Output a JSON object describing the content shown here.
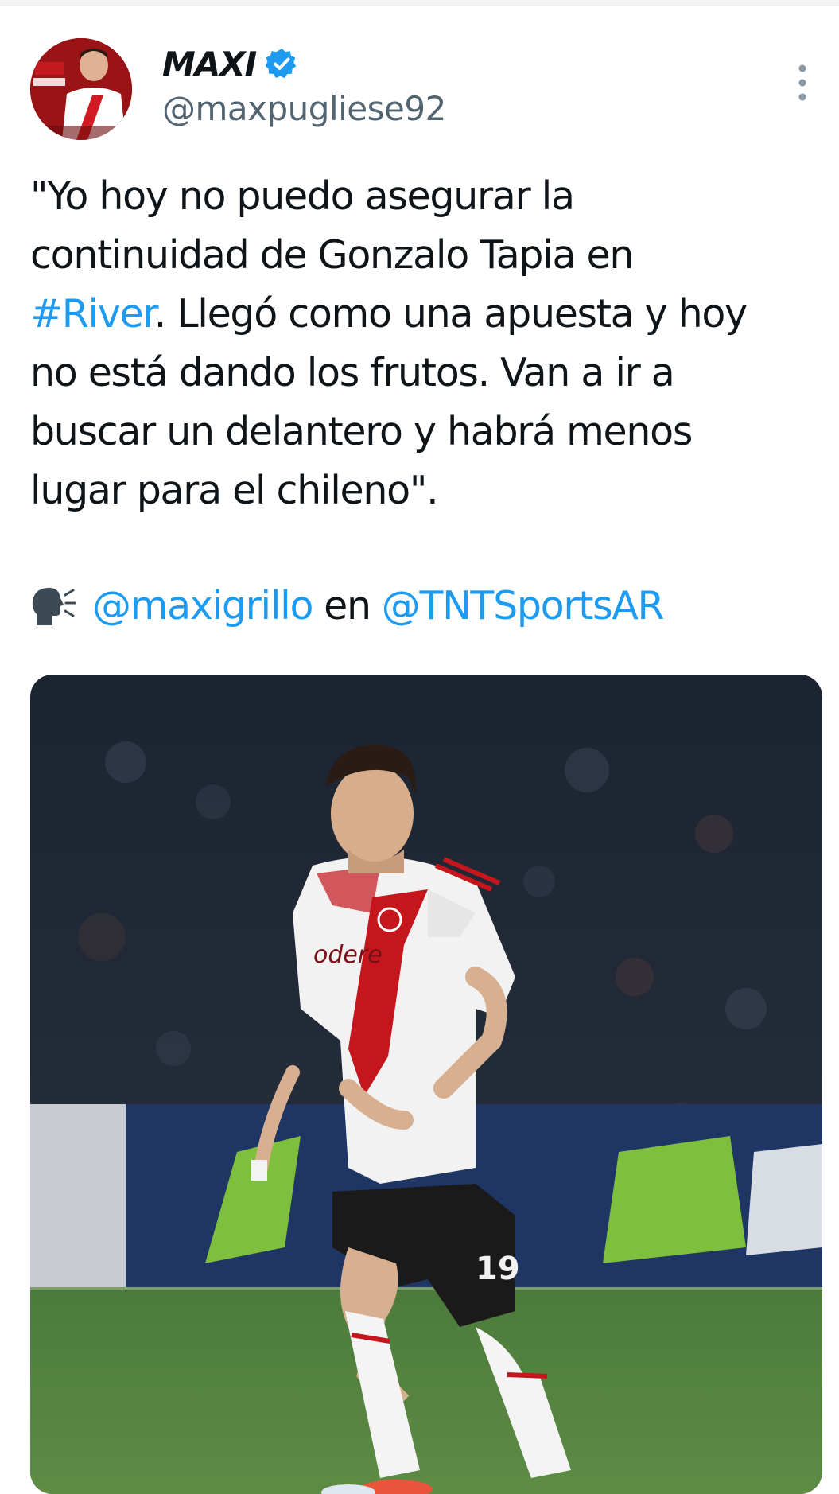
{
  "tweet": {
    "author": {
      "display_name": "MAXI",
      "handle": "@maxpugliese92",
      "avatar_icon": "avatar-photo",
      "verified_icon": "verified-badge-icon",
      "verified_color": "#1d9bf0"
    },
    "menu_icon": "more-vertical-icon",
    "text_lines": [
      {
        "parts": [
          {
            "text": "\"Yo hoy no puedo asegurar la"
          }
        ]
      },
      {
        "parts": [
          {
            "text": "continuidad de Gonzalo Tapia en"
          }
        ]
      },
      {
        "parts": [
          {
            "text": "#River",
            "link": true
          },
          {
            "text": ". Llegó como una apuesta y hoy"
          }
        ]
      },
      {
        "parts": [
          {
            "text": "no está dando los frutos. Van a ir a"
          }
        ]
      },
      {
        "parts": [
          {
            "text": "buscar un delantero y habrá menos"
          }
        ]
      },
      {
        "parts": [
          {
            "text": "lugar para el chileno\"."
          }
        ]
      }
    ],
    "credit": {
      "icon": "speaking-head-icon",
      "mention_1": "@maxigrillo",
      "connector": "en",
      "mention_2": "@TNTSportsAR"
    },
    "media": {
      "type": "photo",
      "subject": "player-photo",
      "jersey_number": "19",
      "sponsor_text": "odere"
    },
    "colors": {
      "link": "#1d9bf0",
      "text": "#0f1419",
      "secondary": "#536471"
    }
  }
}
